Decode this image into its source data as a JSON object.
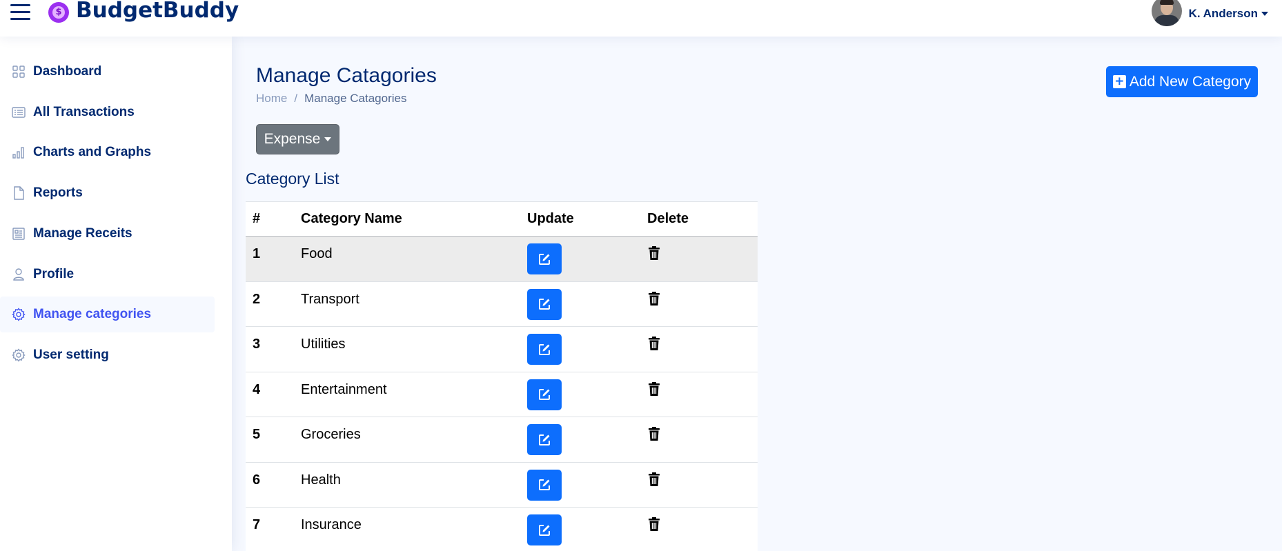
{
  "brand": {
    "name": "BudgetBuddy"
  },
  "user": {
    "name": "K. Anderson"
  },
  "sidebar": {
    "items": [
      {
        "label": "Dashboard",
        "icon": "grid-icon"
      },
      {
        "label": "All Transactions",
        "icon": "list-icon"
      },
      {
        "label": "Charts and Graphs",
        "icon": "bar-chart-icon"
      },
      {
        "label": "Reports",
        "icon": "file-icon"
      },
      {
        "label": "Manage Receits",
        "icon": "receipt-icon"
      },
      {
        "label": "Profile",
        "icon": "person-icon"
      },
      {
        "label": "Manage categories",
        "icon": "gear-icon",
        "active": true
      },
      {
        "label": "User setting",
        "icon": "gear-icon"
      }
    ]
  },
  "page": {
    "title": "Manage Catagories",
    "breadcrumb": {
      "home": "Home",
      "separator": "/",
      "current": "Manage Catagories"
    },
    "add_button": "Add New Category",
    "type_dropdown": "Expense",
    "list_title": "Category List"
  },
  "table": {
    "headers": [
      "#",
      "Category Name",
      "Update",
      "Delete"
    ],
    "rows": [
      {
        "num": "1",
        "name": "Food"
      },
      {
        "num": "2",
        "name": "Transport"
      },
      {
        "num": "3",
        "name": "Utilities"
      },
      {
        "num": "4",
        "name": "Entertainment"
      },
      {
        "num": "5",
        "name": "Groceries"
      },
      {
        "num": "6",
        "name": "Health"
      },
      {
        "num": "7",
        "name": "Insurance"
      }
    ]
  },
  "colors": {
    "primary": "#0d6efd",
    "navy": "#012970",
    "active_link": "#4154f1",
    "secondary_button": "#6c757d",
    "background": "#f6f9ff",
    "logo": "#9b2ff0"
  }
}
